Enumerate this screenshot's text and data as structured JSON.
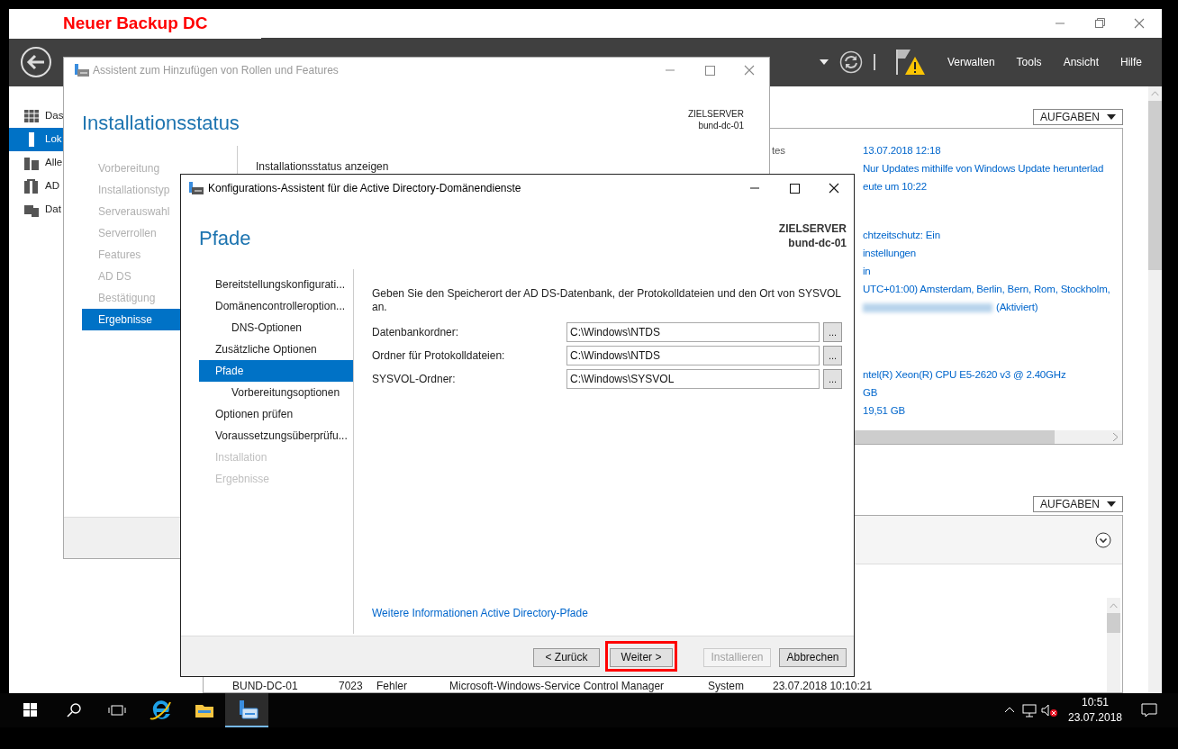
{
  "annotation_label": "Neuer Backup DC",
  "server_manager": {
    "menu": [
      {
        "label": "Verwalten"
      },
      {
        "label": "Tools"
      },
      {
        "label": "Ansicht"
      },
      {
        "label": "Hilfe"
      }
    ],
    "sidebar": [
      {
        "label": "Das",
        "selected": false
      },
      {
        "label": "Lok",
        "selected": true
      },
      {
        "label": "Alle",
        "selected": false
      },
      {
        "label": "AD",
        "selected": false
      },
      {
        "label": "Dat",
        "selected": false
      }
    ],
    "properties": {
      "tasks_button": "AUFGABEN",
      "groups": [
        [
          {
            "label": "tes",
            "value": "13.07.2018 12:18"
          },
          {
            "value": "Nur Updates mithilfe von Windows Update herunterlad"
          },
          {
            "value": "eute um 10:22"
          }
        ],
        [
          {
            "value": "chtzeitschutz: Ein"
          },
          {
            "value": "instellungen"
          },
          {
            "value": "in"
          },
          {
            "value": "UTC+01:00) Amsterdam, Berlin, Bern, Rom, Stockholm,"
          },
          {
            "value": "(Aktiviert)",
            "redacted_prefix": true
          }
        ],
        [
          {
            "value": "ntel(R) Xeon(R) CPU E5-2620 v3 @ 2.40GHz"
          },
          {
            "value": "GB"
          },
          {
            "value": "19,51 GB"
          }
        ]
      ]
    },
    "events": {
      "tasks_button": "AUFGABEN",
      "rows": [
        [
          "BUND-DC-01",
          "7023",
          "Fehler",
          "Microsoft-Windows-Service Control Manager",
          "System",
          "23.07.2018 10:10:21"
        ]
      ]
    }
  },
  "background_wizard": {
    "title": "Assistent zum Hinzufügen von Rollen und Features",
    "heading": "Installationsstatus",
    "target_label": "ZIELSERVER",
    "target_server": "bund-dc-01",
    "nav": [
      {
        "label": "Vorbereitung",
        "selected": false
      },
      {
        "label": "Installationstyp",
        "selected": false
      },
      {
        "label": "Serverauswahl",
        "selected": false
      },
      {
        "label": "Serverrollen",
        "selected": false
      },
      {
        "label": "Features",
        "selected": false
      },
      {
        "label": "AD DS",
        "selected": false
      },
      {
        "label": "Bestätigung",
        "selected": false
      },
      {
        "label": "Ergebnisse",
        "selected": true
      }
    ],
    "content_heading": "Installationsstatus anzeigen"
  },
  "wizard": {
    "title": "Konfigurations-Assistent für die Active Directory-Domänendienste",
    "heading": "Pfade",
    "target_label": "ZIELSERVER",
    "target_server": "bund-dc-01",
    "nav": [
      {
        "label": "Bereitstellungskonfigurati...",
        "selected": false,
        "disabled": false
      },
      {
        "label": "Domänencontrolleroption...",
        "selected": false,
        "disabled": false,
        "children": [
          {
            "label": "DNS-Optionen",
            "selected": false,
            "disabled": false
          }
        ]
      },
      {
        "label": "Zusätzliche Optionen",
        "selected": false,
        "disabled": false
      },
      {
        "label": "Pfade",
        "selected": true,
        "disabled": false,
        "children": [
          {
            "label": "Vorbereitungsoptionen",
            "selected": false,
            "disabled": false
          }
        ]
      },
      {
        "label": "Optionen prüfen",
        "selected": false,
        "disabled": false
      },
      {
        "label": "Voraussetzungsüberprüfu...",
        "selected": false,
        "disabled": false
      },
      {
        "label": "Installation",
        "selected": false,
        "disabled": true
      },
      {
        "label": "Ergebnisse",
        "selected": false,
        "disabled": true
      }
    ],
    "description": "Geben Sie den Speicherort der AD DS-Datenbank, der Protokolldateien und den Ort von SYSVOL an.",
    "fields": [
      {
        "label": "Datenbankordner:",
        "value": "C:\\Windows\\NTDS",
        "browse": "..."
      },
      {
        "label": "Ordner für Protokolldateien:",
        "value": "C:\\Windows\\NTDS",
        "browse": "..."
      },
      {
        "label": "SYSVOL-Ordner:",
        "value": "C:\\Windows\\SYSVOL",
        "browse": "..."
      }
    ],
    "link": "Weitere Informationen Active Directory-Pfade",
    "buttons": [
      {
        "label": "< Zurück",
        "disabled": false,
        "highlighted": false
      },
      {
        "label": "Weiter >",
        "disabled": false,
        "highlighted": true
      },
      {
        "label": "Installieren",
        "disabled": true,
        "highlighted": false
      },
      {
        "label": "Abbrechen",
        "disabled": false,
        "highlighted": false
      }
    ]
  },
  "taskbar": {
    "apps": [
      {
        "kind": "ie",
        "selected": false
      },
      {
        "kind": "explorer",
        "selected": false
      },
      {
        "kind": "server-manager",
        "selected": true
      }
    ],
    "time": "10:51",
    "date": "23.07.2018"
  }
}
